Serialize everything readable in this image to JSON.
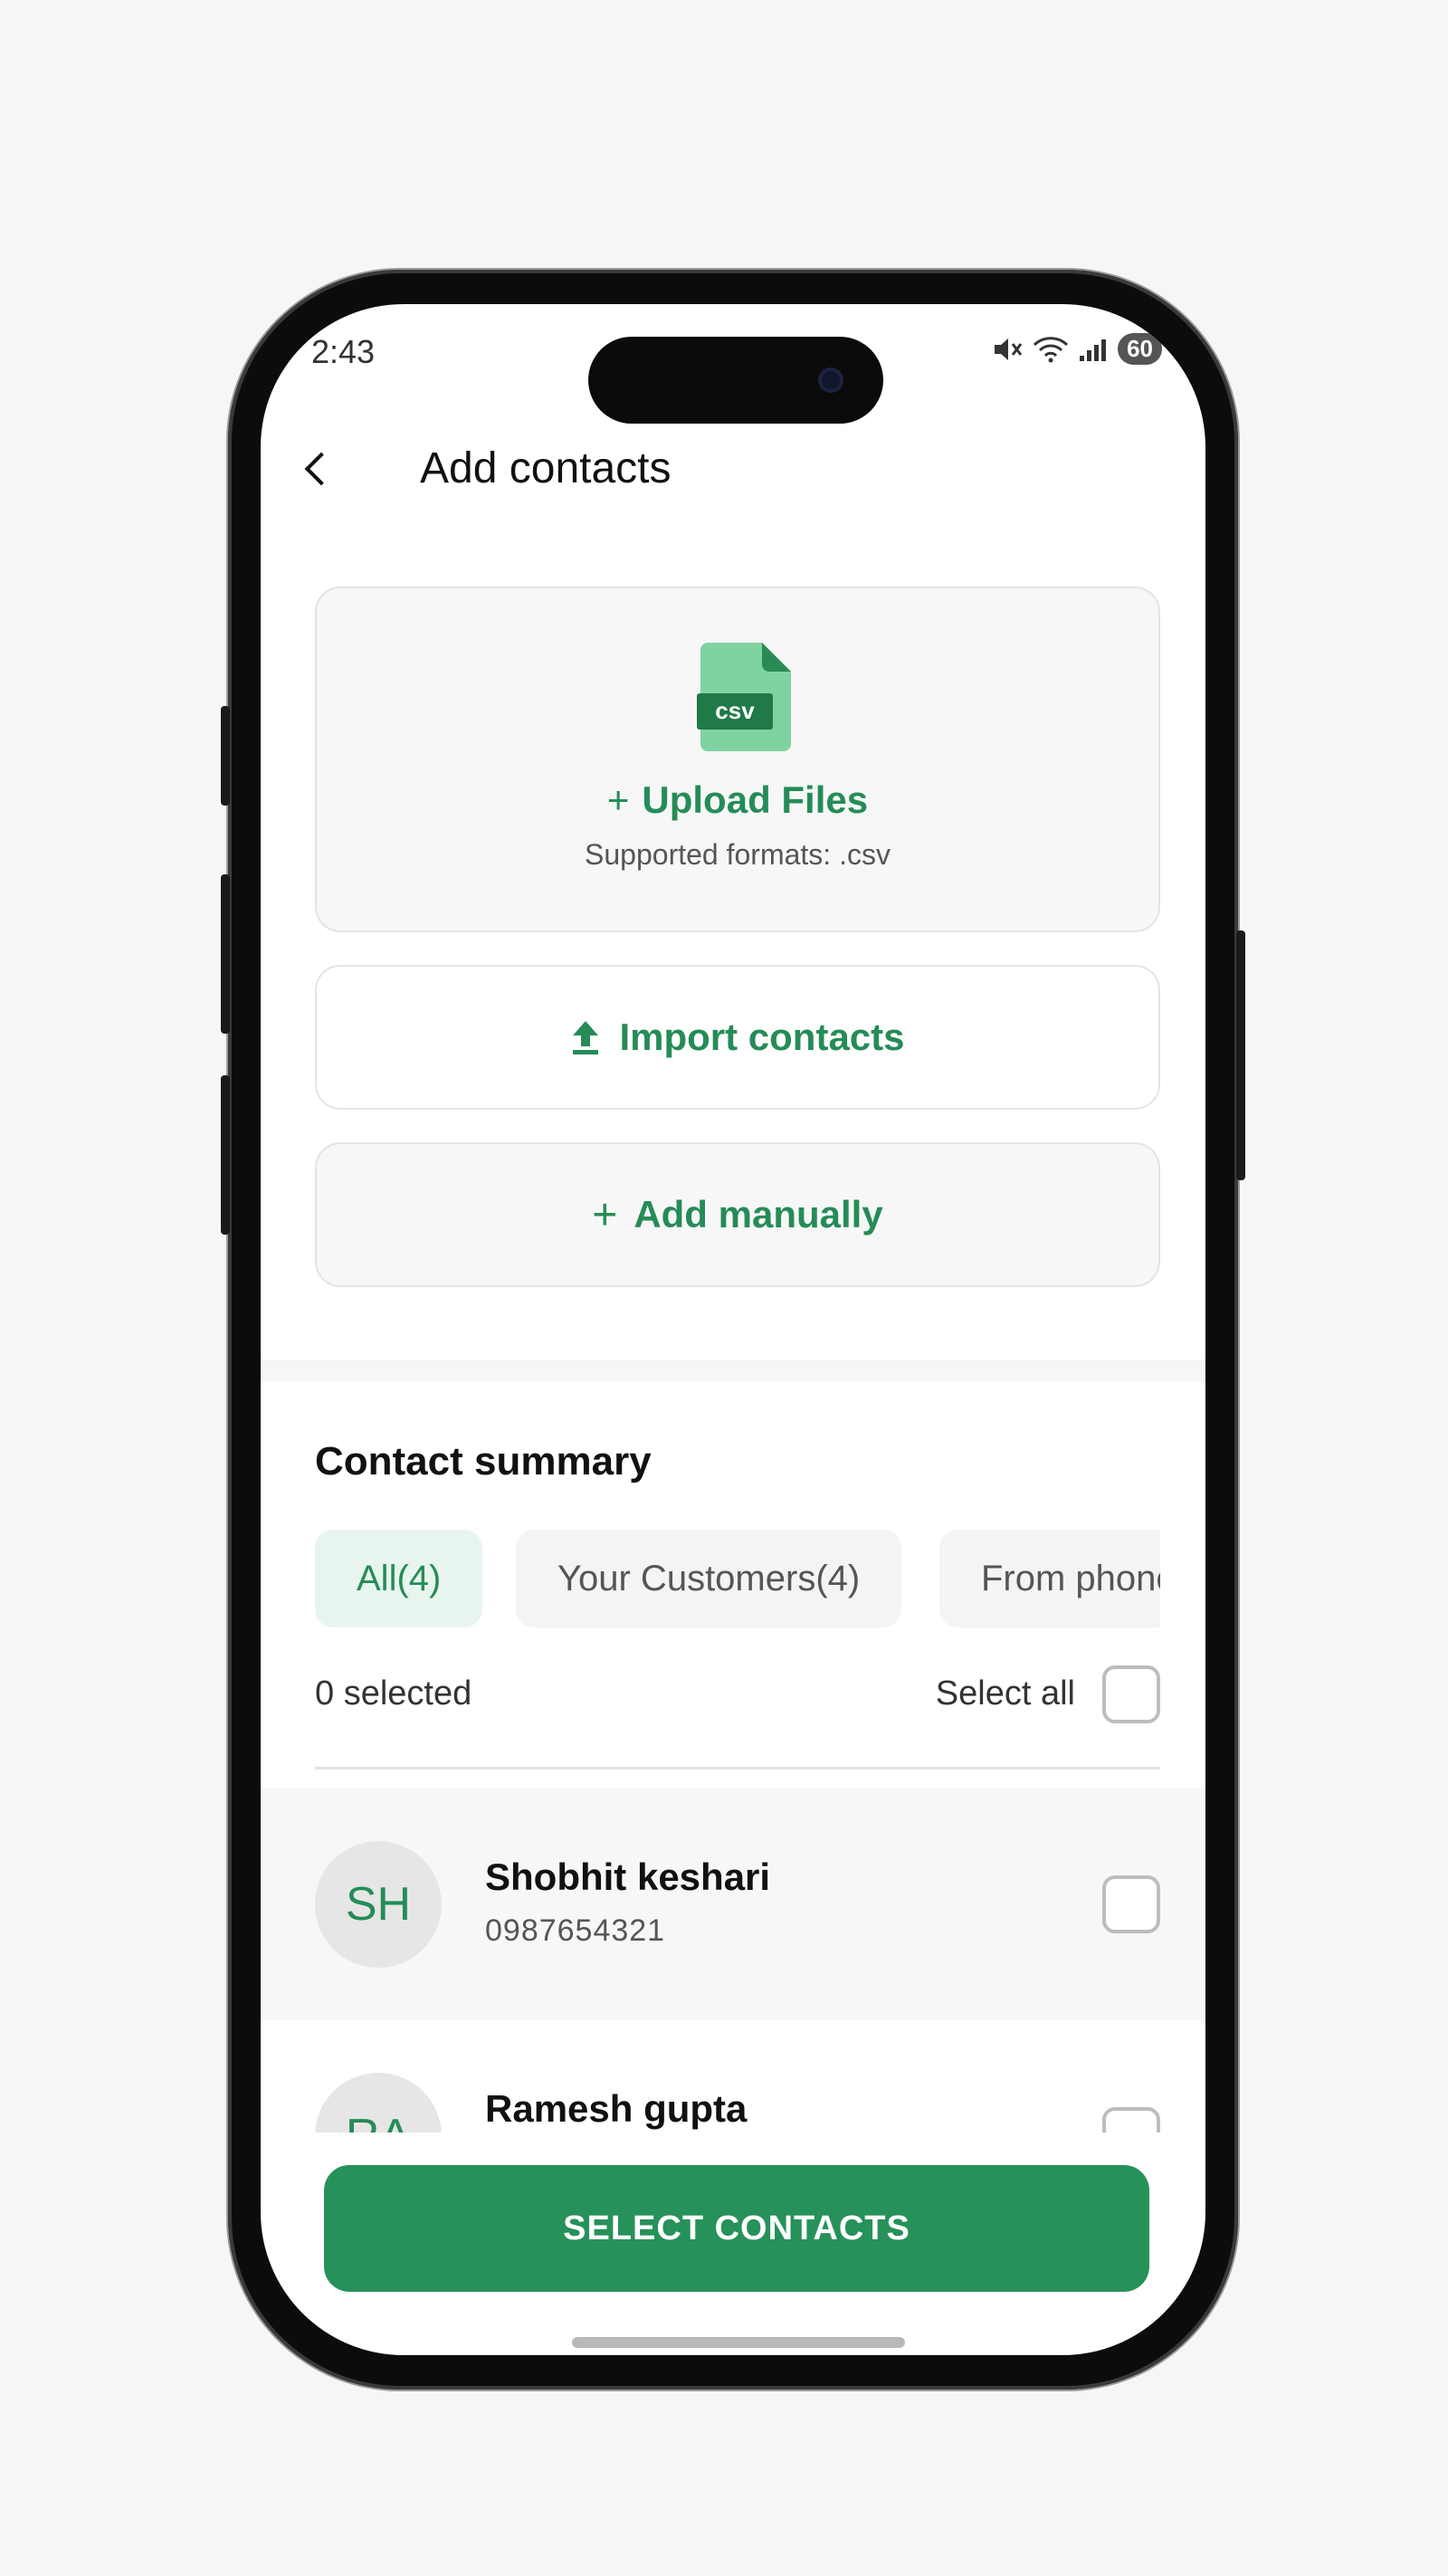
{
  "status_bar": {
    "time": "2:43",
    "battery": "60"
  },
  "header": {
    "title": "Add contacts"
  },
  "upload": {
    "file_type_label": "csv",
    "link_label": "Upload Files",
    "formats": "Supported formats: .csv"
  },
  "actions": {
    "import_label": "Import contacts",
    "manual_label": "Add manually"
  },
  "summary": {
    "title": "Contact summary",
    "chips": [
      "All(4)",
      "Your Customers(4)",
      "From phone"
    ],
    "active_chip": "All(4)",
    "selected_count": "0 selected",
    "select_all_label": "Select all"
  },
  "contacts": [
    {
      "initials": "SH",
      "name": "Shobhit keshari",
      "phone": "0987654321"
    },
    {
      "initials": "RA",
      "name": "Ramesh gupta",
      "phone": ""
    }
  ],
  "footer": {
    "button_label": "SELECT CONTACTS"
  },
  "colors": {
    "brand_green": "#258c57",
    "button_green": "#27915a",
    "chip_active_bg": "#e8f5ee"
  }
}
